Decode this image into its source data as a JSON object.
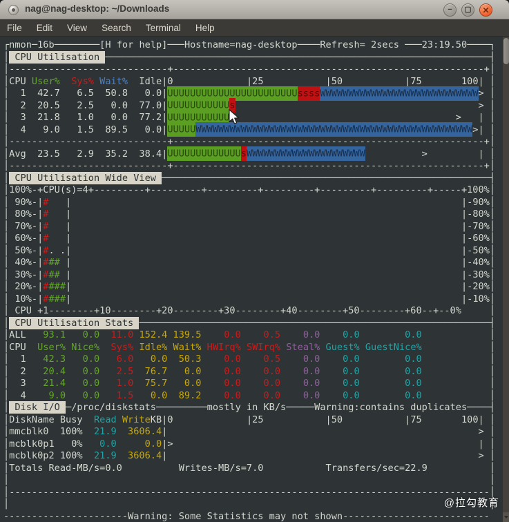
{
  "window": {
    "title": "nag@nag-desktop: ~/Downloads",
    "buttons": {
      "minimize": "−",
      "maximize": "▢",
      "close": "✕"
    }
  },
  "menu": {
    "items": [
      "File",
      "Edit",
      "View",
      "Search",
      "Terminal",
      "Help"
    ]
  },
  "watermark": "@拉勾教育",
  "palette": {
    "terminal_bg": "#2e3436",
    "fg": "#d3d7cf",
    "green": "#63a62a",
    "red": "#cc1a1a",
    "blue": "#4a80c8",
    "yellow": "#c9a800",
    "purple": "#8f5f9b",
    "cyan": "#23a3a5",
    "bar_green": "#5a9e22",
    "bar_red": "#bf1111",
    "bar_blue": "#35659f",
    "highlight_bg": "#d8d5c8",
    "highlight_fg": "#2c3233"
  },
  "terminal": {
    "lines": [
      [
        [
          "┌nmon─16b",
          "w"
        ],
        [
          "─",
          "w",
          8
        ],
        [
          "[H for help]",
          "w"
        ],
        [
          "─",
          "w",
          3
        ],
        [
          "Hostname=nag-desktop",
          "w"
        ],
        [
          "─",
          "w",
          4
        ],
        [
          "Refresh= 2secs ",
          "w"
        ],
        [
          "─",
          "w",
          3
        ],
        [
          "23:19.50",
          "w"
        ],
        [
          "─",
          "w",
          4
        ],
        [
          "┐",
          "w"
        ]
      ],
      [
        [
          "│",
          "w"
        ],
        [
          " CPU Utilisation ",
          "hl"
        ],
        [
          "─",
          "w",
          68
        ],
        [
          "┤",
          "w"
        ]
      ],
      [
        [
          "│",
          "w"
        ],
        [
          "-",
          "w",
          28
        ],
        [
          "+",
          "w"
        ],
        [
          "-",
          "w",
          55
        ],
        [
          "+",
          "w"
        ],
        [
          "│",
          "w"
        ]
      ],
      [
        [
          "│CPU ",
          "w"
        ],
        [
          "User%",
          "g"
        ],
        [
          "  Sys%",
          "r"
        ],
        [
          " Wait%",
          "b"
        ],
        [
          "  Idle",
          "w"
        ],
        [
          "|0",
          "w"
        ],
        [
          " ",
          "w",
          13
        ],
        [
          "|25",
          "w"
        ],
        [
          " ",
          "w",
          11
        ],
        [
          "|50",
          "w"
        ],
        [
          " ",
          "w",
          11
        ],
        [
          "|75",
          "w"
        ],
        [
          " ",
          "w",
          7
        ],
        [
          "100|",
          "w"
        ],
        [
          " │",
          "w"
        ]
      ],
      [
        [
          "│  1  42.7   6.5  50.8   0.0|",
          "w"
        ],
        [
          "U",
          "bg",
          23
        ],
        [
          "s",
          "br",
          4
        ],
        [
          "W",
          "bb",
          28
        ],
        [
          ">",
          "w"
        ],
        [
          " │",
          "w"
        ]
      ],
      [
        [
          "│  2  20.5   2.5   0.0  77.0|",
          "w"
        ],
        [
          "U",
          "bg",
          11
        ],
        [
          "s",
          "br",
          1
        ],
        [
          " ",
          "w",
          43
        ],
        [
          ">",
          "w"
        ],
        [
          " │",
          "w"
        ]
      ],
      [
        [
          "│  3  21.8   1.0   0.0  77.2|",
          "w"
        ],
        [
          "U",
          "bg",
          11
        ],
        [
          " ",
          "w",
          40
        ],
        [
          ">",
          "w"
        ],
        [
          " ",
          "w",
          3
        ],
        [
          "|",
          "w"
        ],
        [
          " │",
          "w"
        ]
      ],
      [
        [
          "│  4   9.0   1.5  89.5   0.0|",
          "w"
        ],
        [
          "U",
          "bg",
          5
        ],
        [
          "W",
          "bb",
          49
        ],
        [
          ">",
          "w"
        ],
        [
          "|",
          "w"
        ],
        [
          " │",
          "w"
        ]
      ],
      [
        [
          "│",
          "w"
        ],
        [
          "-",
          "w",
          28
        ],
        [
          "+",
          "w"
        ],
        [
          "-",
          "w",
          55
        ],
        [
          "+",
          "w"
        ],
        [
          "│",
          "w"
        ]
      ],
      [
        [
          "│Avg  23.5   2.9  35.2  38.4|",
          "w"
        ],
        [
          "U",
          "bg",
          13
        ],
        [
          "s",
          "br",
          1
        ],
        [
          "W",
          "bb",
          21
        ],
        [
          " ",
          "w",
          10
        ],
        [
          ">",
          "w"
        ],
        [
          " ",
          "w",
          9
        ],
        [
          "|",
          "w"
        ],
        [
          " │",
          "w"
        ]
      ],
      [
        [
          "│",
          "w"
        ],
        [
          "-",
          "w",
          28
        ],
        [
          "+",
          "w"
        ],
        [
          "-",
          "w",
          55
        ],
        [
          "+",
          "w"
        ],
        [
          "│",
          "w"
        ]
      ],
      [
        [
          "│",
          "w"
        ],
        [
          " CPU Utilisation Wide View ",
          "hl"
        ],
        [
          "─",
          "w",
          58
        ],
        [
          "┤",
          "w"
        ]
      ],
      [
        [
          "│100%-+CPU(s)=4+",
          "w"
        ],
        [
          "---------+",
          "w",
          6
        ],
        [
          "-----",
          "w"
        ],
        [
          "+100%",
          "w"
        ],
        [
          "│",
          "w"
        ]
      ],
      [
        [
          "│ 90%-|",
          "w"
        ],
        [
          "#",
          "r"
        ],
        [
          " ",
          "w",
          3
        ],
        [
          "|",
          "w"
        ],
        [
          " ",
          "w",
          69
        ],
        [
          "|-90%",
          "w"
        ],
        [
          "│",
          "w"
        ]
      ],
      [
        [
          "│ 80%-|",
          "w"
        ],
        [
          "#",
          "r"
        ],
        [
          " ",
          "w",
          3
        ],
        [
          "|",
          "w"
        ],
        [
          " ",
          "w",
          69
        ],
        [
          "|-80%",
          "w"
        ],
        [
          "│",
          "w"
        ]
      ],
      [
        [
          "│ 70%-|",
          "w"
        ],
        [
          "#",
          "r"
        ],
        [
          " ",
          "w",
          3
        ],
        [
          "|",
          "w"
        ],
        [
          " ",
          "w",
          69
        ],
        [
          "|-70%",
          "w"
        ],
        [
          "│",
          "w"
        ]
      ],
      [
        [
          "│ 60%-|",
          "w"
        ],
        [
          "#",
          "r"
        ],
        [
          " ",
          "w",
          3
        ],
        [
          "|",
          "w"
        ],
        [
          " ",
          "w",
          69
        ],
        [
          "|-60%",
          "w"
        ],
        [
          "│",
          "w"
        ]
      ],
      [
        [
          "│ 50%-|",
          "w"
        ],
        [
          "#",
          "r"
        ],
        [
          ". .",
          "w"
        ],
        [
          "|",
          "w"
        ],
        [
          " ",
          "w",
          69
        ],
        [
          "|-50%",
          "w"
        ],
        [
          "│",
          "w"
        ]
      ],
      [
        [
          "│ 40%-|",
          "w"
        ],
        [
          "#",
          "r"
        ],
        [
          "##",
          "g"
        ],
        [
          " ",
          "w"
        ],
        [
          "|",
          "w"
        ],
        [
          " ",
          "w",
          69
        ],
        [
          "|-40%",
          "w"
        ],
        [
          "│",
          "w"
        ]
      ],
      [
        [
          "│ 30%-|",
          "w"
        ],
        [
          "#",
          "r"
        ],
        [
          "##",
          "g"
        ],
        [
          " ",
          "w"
        ],
        [
          "|",
          "w"
        ],
        [
          " ",
          "w",
          69
        ],
        [
          "|-30%",
          "w"
        ],
        [
          "│",
          "w"
        ]
      ],
      [
        [
          "│ 20%-|",
          "w"
        ],
        [
          "#",
          "r"
        ],
        [
          "###",
          "g"
        ],
        [
          "|",
          "w"
        ],
        [
          " ",
          "w",
          69
        ],
        [
          "|-20%",
          "w"
        ],
        [
          "│",
          "w"
        ]
      ],
      [
        [
          "│ 10%-|",
          "w"
        ],
        [
          "#",
          "r"
        ],
        [
          "###",
          "g"
        ],
        [
          "|",
          "w"
        ],
        [
          " ",
          "w",
          69
        ],
        [
          "|-10%",
          "w"
        ],
        [
          "│",
          "w"
        ]
      ],
      [
        [
          "│ CPU +1--------+10--------+20--------+30--------+40--------+50--------+60--+--0%",
          "w"
        ],
        [
          " ",
          "w",
          5
        ],
        [
          "│",
          "w"
        ]
      ],
      [
        [
          "│",
          "w"
        ],
        [
          " CPU Utilisation Stats ",
          "hl"
        ],
        [
          "─",
          "w",
          62
        ],
        [
          "┤",
          "w"
        ]
      ],
      [
        [
          "│ALL",
          "w"
        ],
        [
          "   93.1",
          "g"
        ],
        [
          "   0.0",
          "g"
        ],
        [
          "  11.0",
          "r"
        ],
        [
          " 152.4",
          "y"
        ],
        [
          " 139.5",
          "y"
        ],
        [
          "    0.0",
          "r"
        ],
        [
          "    0.5",
          "r"
        ],
        [
          "    0.0",
          "p"
        ],
        [
          "    0.0",
          "c"
        ],
        [
          "        0.0",
          "c"
        ],
        [
          " ",
          "w",
          12
        ],
        [
          "│",
          "w"
        ]
      ],
      [
        [
          "│CPU",
          "w"
        ],
        [
          "  User%",
          "g"
        ],
        [
          " Nice%",
          "g"
        ],
        [
          "  Sys%",
          "r"
        ],
        [
          " Idle%",
          "y"
        ],
        [
          " Wait%",
          "y"
        ],
        [
          " HWIrq%",
          "r"
        ],
        [
          " SWIrq%",
          "r"
        ],
        [
          " Steal%",
          "p"
        ],
        [
          " Guest%",
          "c"
        ],
        [
          " GuestNice%",
          "c"
        ],
        [
          " ",
          "w",
          12
        ],
        [
          "│",
          "w"
        ]
      ],
      [
        [
          "│  1",
          "w"
        ],
        [
          "   42.3",
          "g"
        ],
        [
          "   0.0",
          "g"
        ],
        [
          "   6.0",
          "r"
        ],
        [
          "   0.0",
          "y"
        ],
        [
          "  50.3",
          "y"
        ],
        [
          "    0.0",
          "r"
        ],
        [
          "    0.5",
          "r"
        ],
        [
          "    0.0",
          "p"
        ],
        [
          "    0.0",
          "c"
        ],
        [
          "        0.0",
          "c"
        ],
        [
          " ",
          "w",
          12
        ],
        [
          "│",
          "w"
        ]
      ],
      [
        [
          "│  2",
          "w"
        ],
        [
          "   20.4",
          "g"
        ],
        [
          "   0.0",
          "g"
        ],
        [
          "   2.5",
          "r"
        ],
        [
          "  76.7",
          "y"
        ],
        [
          "   0.0",
          "y"
        ],
        [
          "    0.0",
          "r"
        ],
        [
          "    0.0",
          "r"
        ],
        [
          "    0.0",
          "p"
        ],
        [
          "    0.0",
          "c"
        ],
        [
          "        0.0",
          "c"
        ],
        [
          " ",
          "w",
          12
        ],
        [
          "│",
          "w"
        ]
      ],
      [
        [
          "│  3",
          "w"
        ],
        [
          "   21.4",
          "g"
        ],
        [
          "   0.0",
          "g"
        ],
        [
          "   1.0",
          "r"
        ],
        [
          "  75.7",
          "y"
        ],
        [
          "   0.0",
          "y"
        ],
        [
          "    0.0",
          "r"
        ],
        [
          "    0.0",
          "r"
        ],
        [
          "    0.0",
          "p"
        ],
        [
          "    0.0",
          "c"
        ],
        [
          "        0.0",
          "c"
        ],
        [
          " ",
          "w",
          12
        ],
        [
          "│",
          "w"
        ]
      ],
      [
        [
          "│  4",
          "w"
        ],
        [
          "    9.0",
          "g"
        ],
        [
          "   0.0",
          "g"
        ],
        [
          "   1.5",
          "r"
        ],
        [
          "   0.0",
          "y"
        ],
        [
          "  89.2",
          "y"
        ],
        [
          "    0.0",
          "r"
        ],
        [
          "    0.0",
          "r"
        ],
        [
          "    0.0",
          "p"
        ],
        [
          "    0.0",
          "c"
        ],
        [
          "        0.0",
          "c"
        ],
        [
          " ",
          "w",
          12
        ],
        [
          "│",
          "w"
        ]
      ],
      [
        [
          "│",
          "w"
        ],
        [
          " Disk I/O ",
          "hl"
        ],
        [
          "─",
          "w"
        ],
        [
          "/proc/diskstats",
          "w"
        ],
        [
          "─",
          "w",
          9
        ],
        [
          "mostly in KB/s",
          "w"
        ],
        [
          "─",
          "w",
          5
        ],
        [
          "Warning:contains duplicates",
          "w"
        ],
        [
          "─",
          "w",
          4
        ],
        [
          "┤",
          "w"
        ]
      ],
      [
        [
          "│DiskName Busy",
          "w"
        ],
        [
          "  Read",
          "c"
        ],
        [
          " Write",
          "y"
        ],
        [
          "KB",
          "w"
        ],
        [
          "|0",
          "w"
        ],
        [
          " ",
          "w",
          13
        ],
        [
          "|25",
          "w"
        ],
        [
          " ",
          "w",
          11
        ],
        [
          "|50",
          "w"
        ],
        [
          " ",
          "w",
          11
        ],
        [
          "|75",
          "w"
        ],
        [
          " ",
          "w",
          7
        ],
        [
          "100|",
          "w"
        ],
        [
          " │",
          "w"
        ]
      ],
      [
        [
          "│mmcblk0  100%",
          "w"
        ],
        [
          "  21.9",
          "c"
        ],
        [
          "  3606.4",
          "y"
        ],
        [
          "|",
          "w"
        ],
        [
          " ",
          "w",
          55
        ],
        [
          ">",
          "w"
        ],
        [
          " │",
          "w"
        ]
      ],
      [
        [
          "│mcblk0p1   0%",
          "w"
        ],
        [
          "   0.0",
          "c"
        ],
        [
          "     0.0",
          "y"
        ],
        [
          "|",
          "w"
        ],
        [
          ">",
          "w"
        ],
        [
          " ",
          "w",
          54
        ],
        [
          "|",
          "w"
        ],
        [
          " │",
          "w"
        ]
      ],
      [
        [
          "│mcblk0p2 100%",
          "w"
        ],
        [
          "  21.9",
          "c"
        ],
        [
          "  3606.4",
          "y"
        ],
        [
          "|",
          "w"
        ],
        [
          " ",
          "w",
          55
        ],
        [
          ">",
          "w"
        ],
        [
          " │",
          "w"
        ]
      ],
      [
        [
          "│Totals Read-MB/s=0.0",
          "w"
        ],
        [
          " ",
          "w",
          10
        ],
        [
          "Writes-MB/s=7.0",
          "w"
        ],
        [
          " ",
          "w",
          11
        ],
        [
          "Transfers/sec=22.9",
          "w"
        ],
        [
          " ",
          "w",
          11
        ],
        [
          "│",
          "w"
        ]
      ],
      [
        [
          "│",
          "w"
        ],
        [
          " ",
          "w",
          85
        ],
        [
          "│",
          "w"
        ]
      ],
      [
        [
          "│",
          "w"
        ],
        [
          "-",
          "w",
          85
        ],
        [
          "│",
          "w"
        ]
      ],
      [
        [
          "│",
          "w"
        ],
        [
          " ",
          "w",
          85
        ],
        [
          "│",
          "w"
        ]
      ],
      [
        [
          "-",
          "w",
          22
        ],
        [
          "Warning: Some Statistics may not shown",
          "w"
        ],
        [
          "-",
          "w",
          26
        ]
      ]
    ]
  }
}
